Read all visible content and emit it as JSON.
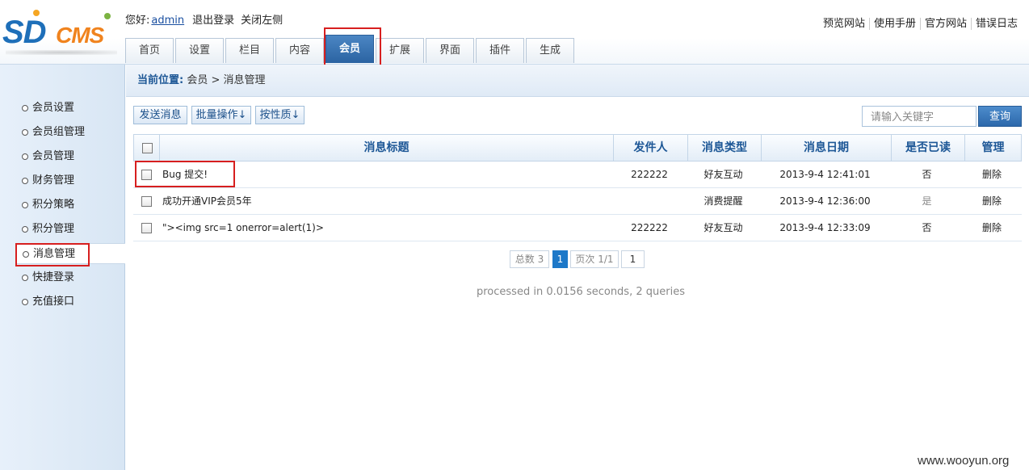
{
  "brand": {
    "logo_sd": "SD",
    "logo_cms": "CMS"
  },
  "header": {
    "greeting": "您好:",
    "user": "admin",
    "logout": "退出登录",
    "close_left": "关闭左侧",
    "links": [
      "预览网站",
      "使用手册",
      "官方网站",
      "错误日志"
    ]
  },
  "tabs": [
    "首页",
    "设置",
    "栏目",
    "内容",
    "会员",
    "扩展",
    "界面",
    "插件",
    "生成"
  ],
  "sidebar": {
    "items": [
      "会员设置",
      "会员组管理",
      "会员管理",
      "财务管理",
      "积分策略",
      "积分管理",
      "消息管理",
      "快捷登录",
      "充值接口"
    ]
  },
  "breadcrumb": {
    "label": "当前位置:",
    "path": "会员 > 消息管理"
  },
  "toolbar": {
    "send": "发送消息",
    "batch": "批量操作↓",
    "by_type": "按性质↓",
    "search_placeholder": "请输入关键字",
    "query": "查询"
  },
  "table": {
    "headers": [
      "消息标题",
      "发件人",
      "消息类型",
      "消息日期",
      "是否已读",
      "管理"
    ],
    "rows": [
      {
        "title": "Bug 提交!",
        "sender": "222222",
        "type": "好友互动",
        "date": "2013-9-4 12:41:01",
        "read": "否",
        "action": "删除"
      },
      {
        "title": "成功开通VIP会员5年",
        "sender": "",
        "type": "消费提醒",
        "date": "2013-9-4 12:36:00",
        "read": "是",
        "action": "删除"
      },
      {
        "title": "\"><img src=1 onerror=alert(1)>",
        "sender": "222222",
        "type": "好友互动",
        "date": "2013-9-4 12:33:09",
        "read": "否",
        "action": "删除"
      }
    ]
  },
  "pager": {
    "total": "总数 3",
    "current": "1",
    "pages": "页次 1/1",
    "goto": "1"
  },
  "footer": {
    "processed": "processed in 0.0156 seconds, 2 queries"
  },
  "watermark": "www.wooyun.org"
}
